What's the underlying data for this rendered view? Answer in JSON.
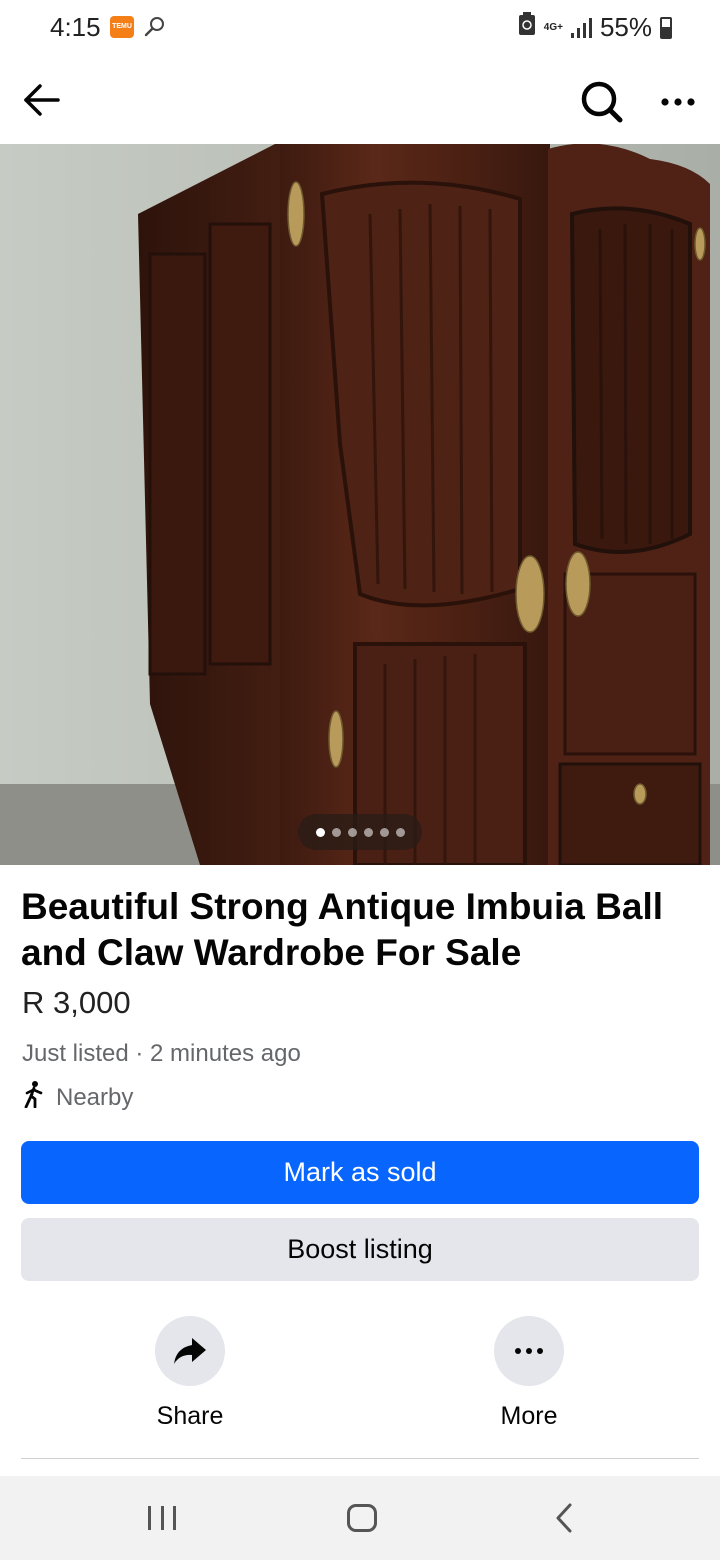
{
  "status_bar": {
    "time": "4:15",
    "notification_app": "TEMU",
    "network": "4G+",
    "battery": "55%"
  },
  "nav": {
    "back_icon": "arrow-left-icon",
    "search_icon": "search-icon",
    "more_icon": "more-horizontal-icon"
  },
  "photo": {
    "image_count": 6,
    "active_index": 0
  },
  "listing": {
    "title": "Beautiful Strong Antique Imbuia Ball and Claw Wardrobe For Sale",
    "price": "R 3,000",
    "listed_time": "Just listed · 2 minutes ago",
    "location": "Nearby"
  },
  "buttons": {
    "primary": "Mark as sold",
    "secondary": "Boost listing"
  },
  "actions": [
    {
      "label": "Share",
      "icon": "share-arrow-icon"
    },
    {
      "label": "More",
      "icon": "more-horizontal-icon"
    }
  ],
  "colors": {
    "accent": "#0866ff",
    "secondary_button": "#e4e6eb",
    "muted_text": "#65676b"
  }
}
